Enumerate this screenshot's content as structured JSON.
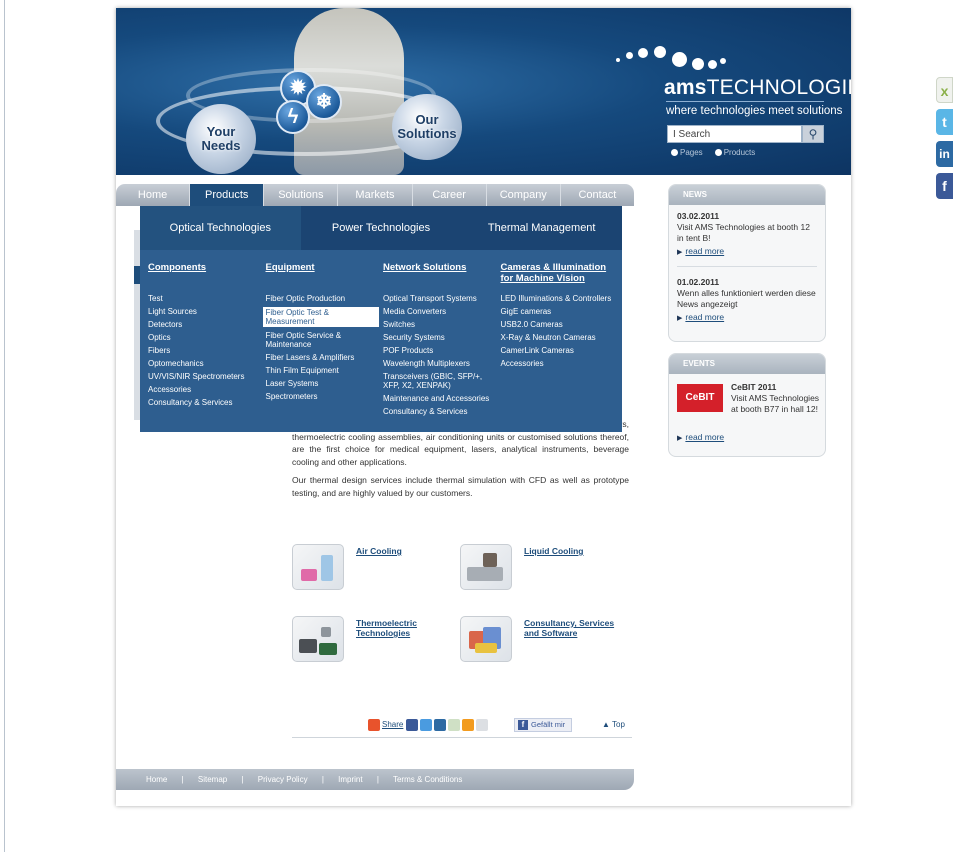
{
  "header": {
    "brand_bold": "ams",
    "brand_rest": "TECHNOLOGIES",
    "tagline": "where technologies meet solutions",
    "bubble_left": "Your Needs",
    "bubble_right": "Our Solutions",
    "search_placeholder": "I Search",
    "search_icon": "search-icon",
    "radio_pages": "Pages",
    "radio_products": "Products"
  },
  "nav": {
    "items": [
      "Home",
      "Products",
      "Solutions",
      "Markets",
      "Career",
      "Company",
      "Contact"
    ],
    "active": "Products"
  },
  "mega": {
    "tabs": [
      "Optical Technologies",
      "Power Technologies",
      "Thermal Management"
    ],
    "selected_tab": "Optical Technologies",
    "columns": [
      {
        "title": "Components",
        "items": [
          "Test",
          "Light Sources",
          "Detectors",
          "Optics",
          "Fibers",
          "Optomechanics",
          "UV/VIS/NIR Spectrometers",
          "Accessories",
          "Consultancy & Services"
        ]
      },
      {
        "title": "Equipment",
        "items": [
          "Fiber Optic Production",
          "Fiber Optic Test & Measurement",
          "Fiber Optic Service & Maintenance",
          "Fiber Lasers & Amplifiers",
          "Thin Film Equipment",
          "Laser Systems",
          "Spectrometers"
        ],
        "highlighted": "Fiber Optic Test & Measurement"
      },
      {
        "title": "Network Solutions",
        "items": [
          "Optical Transport Systems",
          "Media Converters",
          "Switches",
          "Security Systems",
          "POF Products",
          "Wavelength Multiplexers",
          "Transceivers (GBIC, SFP/+, XFP, X2, XENPAK)",
          "Maintenance and Accessories",
          "Consultancy & Services"
        ]
      },
      {
        "title": "Cameras & Illumination for Machine Vision",
        "items": [
          "LED Illuminations & Controllers",
          "GigE cameras",
          "USB2.0 Cameras",
          "X-Ray & Neutron Cameras",
          "CamerLink Cameras",
          "Accessories"
        ]
      }
    ]
  },
  "content": {
    "para1": "compressors and heat pipes, as well as systems such as recirculating chillers, thermoelectric cooling assemblies, air conditioning units or customised solutions thereof, are the first choice for medical equipment, lasers, analytical instruments, beverage cooling and other applications.",
    "para2": "Our thermal design services include thermal simulation with CFD as well as prototype testing, and are highly valued by our customers.",
    "tiles": [
      {
        "label": "Air Cooling"
      },
      {
        "label": "Liquid Cooling"
      },
      {
        "label": "Thermoelectric Technologies"
      },
      {
        "label": "Consultancy, Services and Software"
      }
    ]
  },
  "share": {
    "share_label": "Share",
    "like_label": "Gefällt mir",
    "top_label": "Top"
  },
  "footer": {
    "links": [
      "Home",
      "|",
      "Sitemap",
      "|",
      "Privacy Policy",
      "|",
      "Imprint",
      "|",
      "Terms & Conditions"
    ]
  },
  "news": {
    "title": "NEWS",
    "items": [
      {
        "date": "03.02.2011",
        "text": "Visit AMS Technologies at booth 12 in tent B!",
        "more": "read more"
      },
      {
        "date": "01.02.2011",
        "text": "Wenn alles funktioniert werden diese News angezeigt",
        "more": "read more"
      }
    ]
  },
  "events": {
    "title": "EVENTS",
    "logo": "CeBIT",
    "name": "CeBIT 2011",
    "text": "Visit AMS Technologies at booth B77 in hall 12!",
    "more": "read more"
  },
  "social": [
    {
      "name": "xing-icon",
      "glyph": "x",
      "color": "#f0f2ee"
    },
    {
      "name": "twitter-icon",
      "glyph": "t",
      "color": "#5ab6e6"
    },
    {
      "name": "linkedin-icon",
      "glyph": "in",
      "color": "#2d6aa3"
    },
    {
      "name": "facebook-icon",
      "glyph": "f",
      "color": "#3b5998"
    }
  ]
}
